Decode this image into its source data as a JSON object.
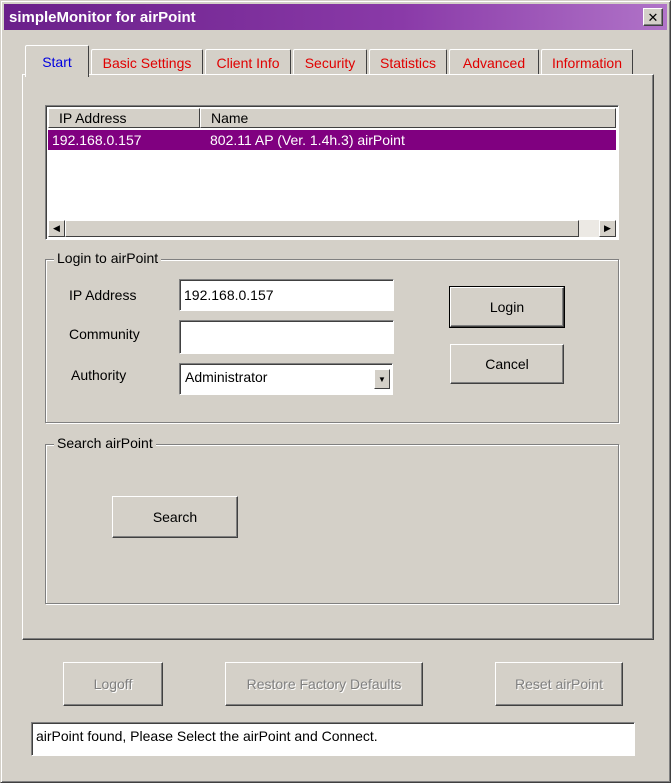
{
  "window": {
    "title": "simpleMonitor for airPoint",
    "close": "✕"
  },
  "tabs": [
    {
      "label": "Start",
      "active": true
    },
    {
      "label": "Basic Settings",
      "active": false
    },
    {
      "label": "Client Info",
      "active": false
    },
    {
      "label": "Security",
      "active": false
    },
    {
      "label": "Statistics",
      "active": false
    },
    {
      "label": "Advanced",
      "active": false
    },
    {
      "label": "Information",
      "active": false
    }
  ],
  "device_list": {
    "columns": [
      "IP Address",
      "Name"
    ],
    "rows": [
      {
        "ip": "192.168.0.157",
        "name": "802.11 AP (Ver. 1.4h.3) airPoint",
        "selected": true
      }
    ]
  },
  "login": {
    "title": "Login to airPoint",
    "ip_label": "IP Address",
    "ip_value": "192.168.0.157",
    "community_label": "Community",
    "community_value": "",
    "authority_label": "Authority",
    "authority_value": "Administrator",
    "login_button": "Login",
    "cancel_button": "Cancel"
  },
  "search": {
    "title": "Search airPoint",
    "search_button": "Search"
  },
  "footer": {
    "logoff": "Logoff",
    "restore": "Restore Factory Defaults",
    "reset": "Reset airPoint"
  },
  "status": {
    "message": "airPoint found, Please Select the airPoint and Connect."
  },
  "colors": {
    "title_bar": "#6a1f8a",
    "selection": "#800080",
    "tab_text": "#e00000",
    "active_tab_text": "#0000e0"
  }
}
